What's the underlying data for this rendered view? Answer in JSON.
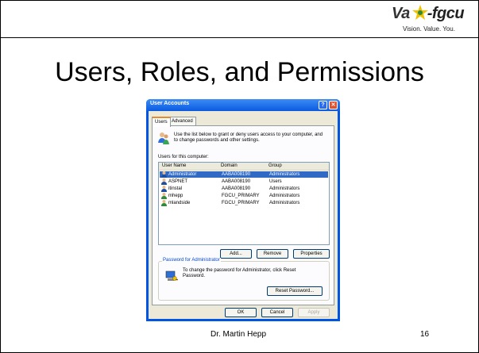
{
  "slide": {
    "title": "Users, Roles, and Permissions",
    "footer_name": "Dr. Martin Hepp",
    "page_number": "16",
    "logo": {
      "word_left": "Va",
      "word_right": "-fgcu",
      "tagline": "Vision. Value. You."
    }
  },
  "dialog": {
    "title": "User Accounts",
    "help_label": "?",
    "close_label": "✕",
    "tabs": [
      {
        "label": "Users"
      },
      {
        "label": "Advanced"
      }
    ],
    "intro_text": "Use the list below to grant or deny users access to your computer, and to change passwords and other settings.",
    "list_label": "Users for this computer:",
    "columns": {
      "user_name": "User Name",
      "domain": "Domain",
      "group": "Group"
    },
    "rows": [
      {
        "user": "Administrator",
        "domain": "AABA008190",
        "group": "Administrators",
        "selected": true
      },
      {
        "user": "ASPNET",
        "domain": "AABA008190",
        "group": "Users",
        "selected": false
      },
      {
        "user": "itinstal",
        "domain": "AABA008190",
        "group": "Administrators",
        "selected": false
      },
      {
        "user": "mhepp",
        "domain": "FGCU_PRIMARY",
        "group": "Administrators",
        "selected": false
      },
      {
        "user": "mlandside",
        "domain": "FGCU_PRIMARY",
        "group": "Administrators",
        "selected": false
      }
    ],
    "buttons": {
      "add": "Add...",
      "remove": "Remove",
      "properties": "Properties"
    },
    "password_group": {
      "label": "Password for Administrator",
      "text": "To change the password for Administrator, click Reset Password.",
      "reset_button": "Reset Password..."
    },
    "footer_buttons": {
      "ok": "OK",
      "cancel": "Cancel",
      "apply": "Apply"
    }
  },
  "colors": {
    "xp_blue": "#0055e5",
    "selection": "#316ac5",
    "dialog_face": "#ece9d8"
  }
}
